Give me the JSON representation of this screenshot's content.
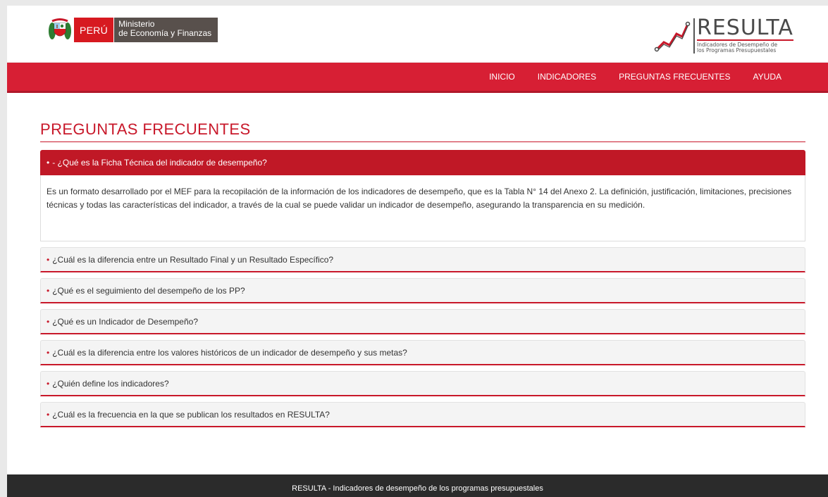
{
  "header": {
    "gov_logo": {
      "country": "PERÚ",
      "ministry_line1": "Ministerio",
      "ministry_line2": "de Economía y Finanzas",
      "crest_icon": "peru-coat-of-arms-icon"
    },
    "brand_logo": {
      "title": "RESULTA",
      "subtitle_line1": "Indicadores de Desempeño de",
      "subtitle_line2": "los Programas Presupuestales",
      "mark_icon": "line-chart-icon"
    }
  },
  "nav": {
    "items": [
      {
        "label": "INICIO"
      },
      {
        "label": "INDICADORES"
      },
      {
        "label": "PREGUNTAS FRECUENTES"
      },
      {
        "label": "AYUDA"
      }
    ]
  },
  "main": {
    "title": "PREGUNTAS FRECUENTES",
    "faq": [
      {
        "question": "- ¿Qué es la Ficha Técnica del indicador de desempeño?",
        "expanded": true,
        "answer": "Es un formato desarrollado por el MEF para la recopilación de la información de los indicadores de desempeño, que es la Tabla N° 14 del Anexo 2. La definición, justificación, limitaciones, precisiones técnicas y todas las características del indicador, a través de la cual se puede validar un indicador de desempeño, asegurando la transparencia en su medición."
      },
      {
        "question": "¿Cuál es la diferencia entre un Resultado Final y un Resultado Específico?",
        "expanded": false
      },
      {
        "question": "¿Qué es el seguimiento del desempeño de los PP?",
        "expanded": false
      },
      {
        "question": "¿Qué es un Indicador de Desempeño?",
        "expanded": false
      },
      {
        "question": "¿Cuál es la diferencia entre los valores históricos de un indicador de desempeño y sus metas?",
        "expanded": false
      },
      {
        "question": "¿Quién define los indicadores?",
        "expanded": false
      },
      {
        "question": "¿Cuál es la frecuencia en la que se publican los resultados en RESULTA?",
        "expanded": false
      }
    ]
  },
  "footer": {
    "text": "RESULTA - Indicadores de desempeño de los programas presupuestales"
  },
  "colors": {
    "brand_red": "#d71f34",
    "dark_red": "#c01826",
    "footer_bg": "#2b2b2b",
    "ministry_gray": "#58504c"
  }
}
